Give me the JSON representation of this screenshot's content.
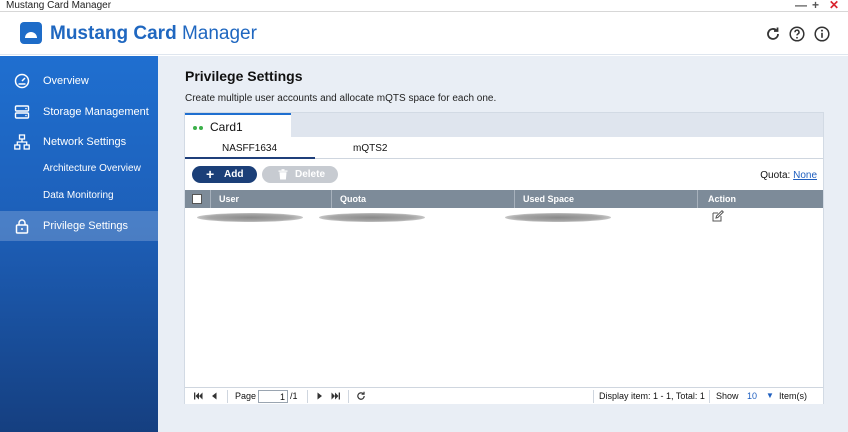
{
  "window": {
    "title": "Mustang Card Manager",
    "min": "—",
    "max": "+",
    "close": "✕"
  },
  "header": {
    "title_bold": "Mustang Card",
    "title_rest": " Manager"
  },
  "sidebar": {
    "items": [
      {
        "label": "Overview",
        "icon": "dashboard-icon"
      },
      {
        "label": "Storage Management",
        "icon": "storage-icon"
      },
      {
        "label": "Network Settings",
        "icon": "network-icon"
      },
      {
        "label": "Privilege Settings",
        "icon": "lock-icon"
      }
    ],
    "subitems": [
      "Architecture Overview",
      "Data Monitoring"
    ],
    "active": "Privilege Settings"
  },
  "page": {
    "title": "Privilege Settings",
    "description": "Create multiple user accounts and allocate mQTS space for each one."
  },
  "card_tab": {
    "label": "Card1"
  },
  "sub_tabs": [
    "NASFF1634",
    "mQTS2"
  ],
  "toolbar": {
    "add_label": "Add",
    "delete_label": "Delete",
    "quota_label": "Quota:",
    "quota_value": "None"
  },
  "table": {
    "columns": [
      "User",
      "Quota",
      "Used Space",
      "Action"
    ]
  },
  "pager": {
    "page_label": "Page",
    "page_value": "1",
    "page_total": "/1",
    "display": "Display item: 1 - 1, Total: 1",
    "show_label": "Show",
    "show_value": "10",
    "items_label": "Item(s)"
  },
  "colors": {
    "accent": "#1f6fd0",
    "add_button": "#1b3f78",
    "header_row": "#7d8b99"
  }
}
